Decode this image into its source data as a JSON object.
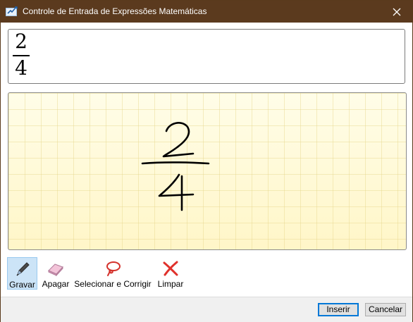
{
  "window": {
    "title": "Controle de Entrada de Expressões Matemáticas",
    "title_icon": "math-input-icon",
    "close_icon": "close-icon"
  },
  "preview": {
    "numerator": "2",
    "denominator": "4"
  },
  "tools": [
    {
      "label": "Gravar",
      "icon": "pen-icon",
      "active": true
    },
    {
      "label": "Apagar",
      "icon": "eraser-icon",
      "active": false
    },
    {
      "label": "Selecionar e Corrigir",
      "icon": "lasso-icon",
      "active": false
    },
    {
      "label": "Limpar",
      "icon": "clear-x-icon",
      "active": false
    }
  ],
  "footer": {
    "insert_label": "Inserir",
    "cancel_label": "Cancelar"
  },
  "colors": {
    "titlebar": "#5b3a1e",
    "canvas_top": "#fffde8",
    "canvas_bottom": "#fff6c8",
    "active_tool": "#cce4f7",
    "clear_red": "#e0312b",
    "lasso_red": "#d4322c"
  }
}
